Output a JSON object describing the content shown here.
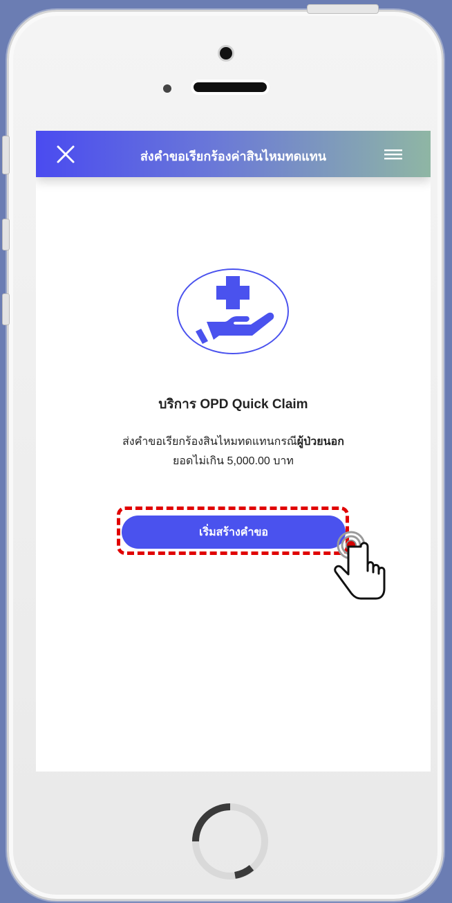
{
  "appbar": {
    "title": "ส่งคำขอเรียกร้องค่าสินไหมทดแทน",
    "close_icon": "close-icon",
    "menu_icon": "menu-icon"
  },
  "hero": {
    "icon": "medical-cross-hand-icon"
  },
  "service": {
    "title": "บริการ OPD Quick Claim",
    "description_prefix": "ส่งคำขอเรียกร้องสินไหมทดแทนกรณี",
    "description_bold": "ผู้ป่วยนอก",
    "description_line2": "ยอดไม่เกิน 5,000.00 บาท"
  },
  "actions": {
    "start_label": "เริ่มสร้างคำขอ"
  },
  "overlay": {
    "pointer_icon": "tap-hand-icon",
    "highlight_color": "#e00000"
  },
  "colors": {
    "primary": "#4a52ee",
    "appbar_start": "#4a4bf0",
    "appbar_end": "#8fb6a4"
  }
}
